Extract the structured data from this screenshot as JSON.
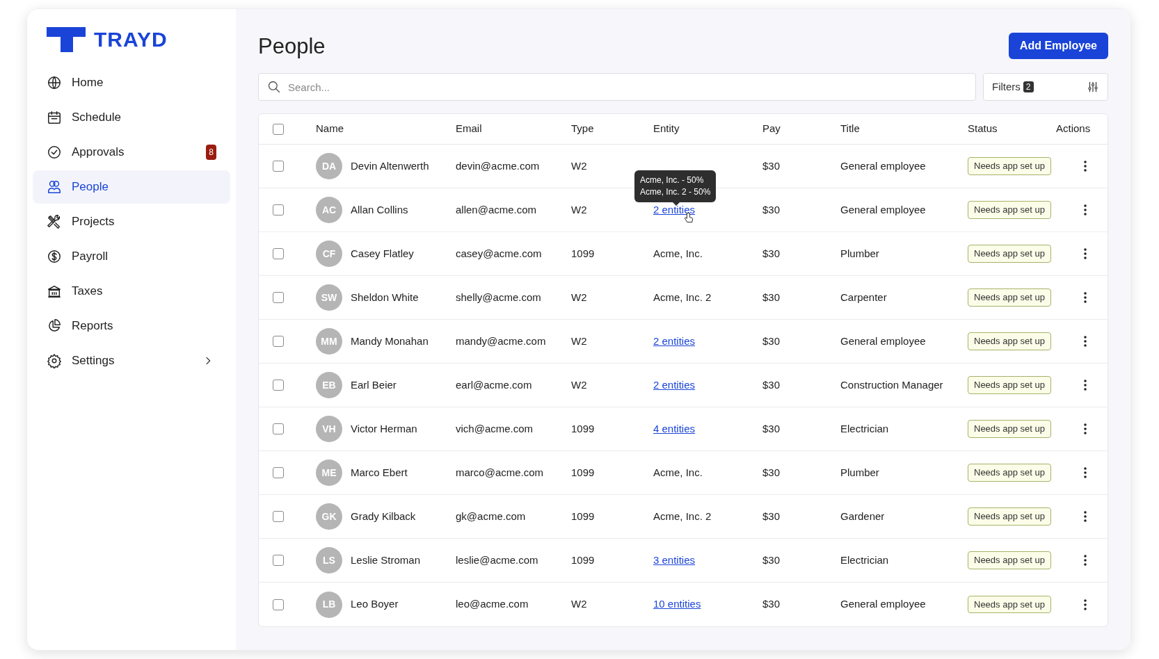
{
  "brand": {
    "name": "TRAYD"
  },
  "sidebar": {
    "items": [
      {
        "label": "Home",
        "selected": false
      },
      {
        "label": "Schedule",
        "selected": false
      },
      {
        "label": "Approvals",
        "selected": false,
        "badge": "8"
      },
      {
        "label": "People",
        "selected": true
      },
      {
        "label": "Projects",
        "selected": false
      },
      {
        "label": "Payroll",
        "selected": false
      },
      {
        "label": "Taxes",
        "selected": false
      },
      {
        "label": "Reports",
        "selected": false
      },
      {
        "label": "Settings",
        "selected": false,
        "submenu": true
      }
    ]
  },
  "page": {
    "title": "People",
    "add_button": "Add Employee"
  },
  "search": {
    "placeholder": "Search..."
  },
  "filters": {
    "label": "Filters",
    "count": "2"
  },
  "table": {
    "select_all": {
      "checked": false
    },
    "columns": [
      "Name",
      "Email",
      "Type",
      "Entity",
      "Pay",
      "Title",
      "Status",
      "Actions"
    ],
    "rows": [
      {
        "checked": false,
        "initials": "DA",
        "name": "Devin Altenwerth",
        "email": "devin@acme.com",
        "type": "W2",
        "pay": "$30",
        "title": "General employee",
        "status": "Needs app set up"
      },
      {
        "checked": false,
        "initials": "AC",
        "name": "Allan Collins",
        "email": "allen@acme.com",
        "type": "W2",
        "entity": {
          "text": "2 entities",
          "link": true
        },
        "tooltip": [
          "Acme, Inc. - 50%",
          "Acme, Inc. 2 - 50%"
        ],
        "pay": "$30",
        "title": "General employee",
        "status": "Needs app set up"
      },
      {
        "checked": false,
        "initials": "CF",
        "name": "Casey Flatley",
        "email": "casey@acme.com",
        "type": "1099",
        "entity": {
          "text": "Acme, Inc.",
          "link": false
        },
        "pay": "$30",
        "title": "Plumber",
        "status": "Needs app set up"
      },
      {
        "checked": false,
        "initials": "SW",
        "name": "Sheldon White",
        "email": "shelly@acme.com",
        "type": "W2",
        "entity": {
          "text": "Acme, Inc. 2",
          "link": false
        },
        "pay": "$30",
        "title": "Carpenter",
        "status": "Needs app set up"
      },
      {
        "checked": false,
        "initials": "MM",
        "name": "Mandy Monahan",
        "email": "mandy@acme.com",
        "type": "W2",
        "entity": {
          "text": "2 entities",
          "link": true
        },
        "pay": "$30",
        "title": "General employee",
        "status": "Needs app set up"
      },
      {
        "checked": false,
        "initials": "EB",
        "name": "Earl Beier",
        "email": "earl@acme.com",
        "type": "W2",
        "entity": {
          "text": "2 entities",
          "link": true
        },
        "pay": "$30",
        "title": "Construction Manager",
        "status": "Needs app set up"
      },
      {
        "checked": false,
        "initials": "VH",
        "name": "Victor Herman",
        "email": "vich@acme.com",
        "type": "1099",
        "entity": {
          "text": "4 entities",
          "link": true
        },
        "pay": "$30",
        "title": "Electrician",
        "status": "Needs app set up"
      },
      {
        "checked": false,
        "initials": "ME",
        "name": "Marco Ebert",
        "email": "marco@acme.com",
        "type": "1099",
        "entity": {
          "text": "Acme, Inc.",
          "link": false
        },
        "pay": "$30",
        "title": "Plumber",
        "status": "Needs app set up"
      },
      {
        "checked": false,
        "initials": "GK",
        "name": "Grady Kilback",
        "email": "gk@acme.com",
        "type": "1099",
        "entity": {
          "text": "Acme, Inc. 2",
          "link": false
        },
        "pay": "$30",
        "title": "Gardener",
        "status": "Needs app set up"
      },
      {
        "checked": false,
        "initials": "LS",
        "name": "Leslie Stroman",
        "email": "leslie@acme.com",
        "type": "1099",
        "entity": {
          "text": "3 entities",
          "link": true
        },
        "pay": "$30",
        "title": "Electrician",
        "status": "Needs app set up"
      },
      {
        "checked": false,
        "initials": "LB",
        "name": "Leo Boyer",
        "email": "leo@acme.com",
        "type": "W2",
        "entity": {
          "text": "10 entities",
          "link": true
        },
        "pay": "$30",
        "title": "General employee",
        "status": "Needs app set up"
      }
    ]
  }
}
